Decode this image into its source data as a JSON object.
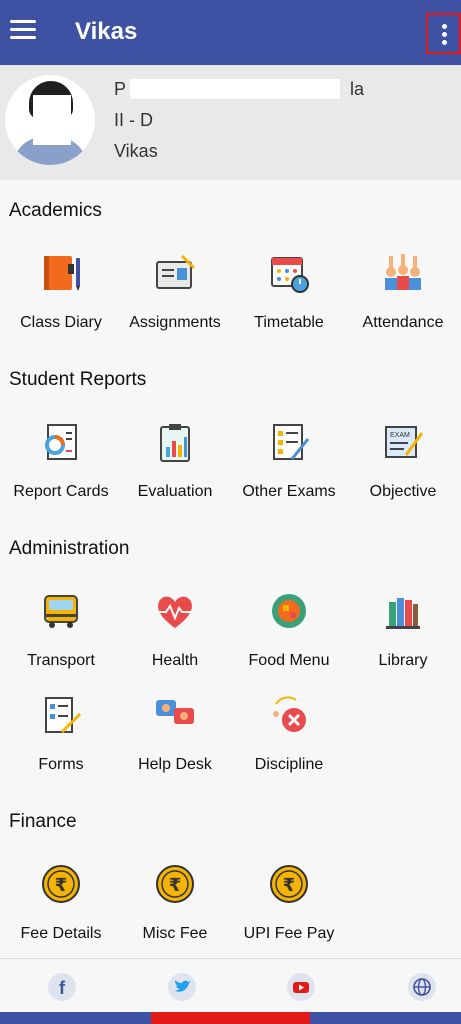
{
  "app_bar": {
    "title": "Vikas",
    "menu_icon": "hamburger-icon",
    "more_icon": "more-vertical-icon"
  },
  "profile": {
    "name": "P",
    "name_suffix": "la",
    "class": "II - D",
    "school": "Vikas"
  },
  "sections": {
    "academics": {
      "title": "Academics",
      "items": [
        "Class Diary",
        "Assignments",
        "Timetable",
        "Attendance"
      ]
    },
    "student_reports": {
      "title": "Student Reports",
      "items": [
        "Report Cards",
        "Evaluation",
        "Other Exams",
        "Objective"
      ]
    },
    "administration": {
      "title": "Administration",
      "items": [
        "Transport",
        "Health",
        "Food Menu",
        "Library",
        "Forms",
        "Help Desk",
        "Discipline"
      ]
    },
    "finance": {
      "title": "Finance",
      "items": [
        "Fee Details",
        "Misc Fee",
        "UPI Fee Pay"
      ]
    }
  },
  "footer": {
    "icons": [
      "facebook-icon",
      "twitter-icon",
      "youtube-icon",
      "globe-icon"
    ]
  },
  "colors": {
    "app_bar": "#3f51a3",
    "highlight": "#e21a1a",
    "coin": "#f4b400"
  }
}
